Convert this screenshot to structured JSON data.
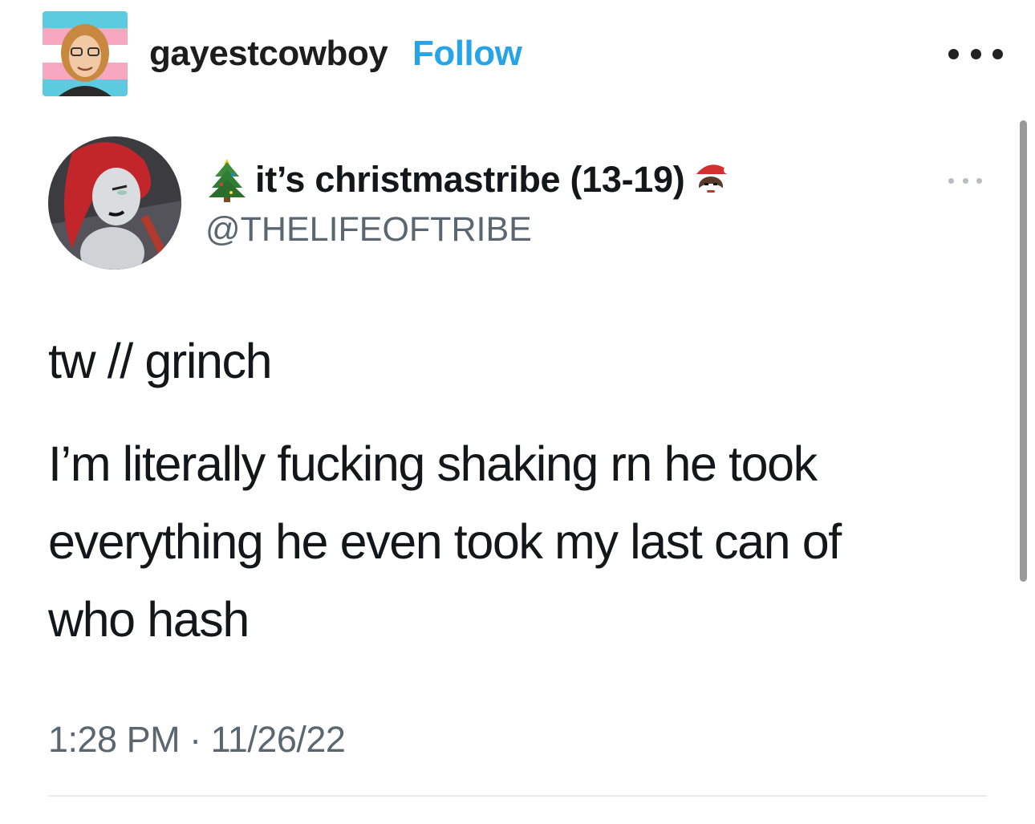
{
  "post": {
    "blog_name": "gayestcowboy",
    "follow_label": "Follow",
    "avatar_icon": "user-avatar-illustration",
    "menu_icon": "more-horizontal-icon"
  },
  "tweet": {
    "display_name": "it’s christmastribe (13-19)",
    "display_name_prefix_icon": "christmas-tree-emoji",
    "display_name_suffix_icon": "santa-emoji",
    "handle": "@THELIFEOFTRIBE",
    "body_lines": [
      "tw // grinch",
      "I’m literally fucking shaking rn he took",
      "everything he even took my last can of",
      "who hash"
    ],
    "timestamp": "1:28 PM · 11/26/22",
    "menu_icon": "more-horizontal-icon"
  },
  "colors": {
    "follow": "#27a4e8",
    "text": "#14171a",
    "muted": "#5b6770",
    "divider": "#e6ecf0"
  }
}
